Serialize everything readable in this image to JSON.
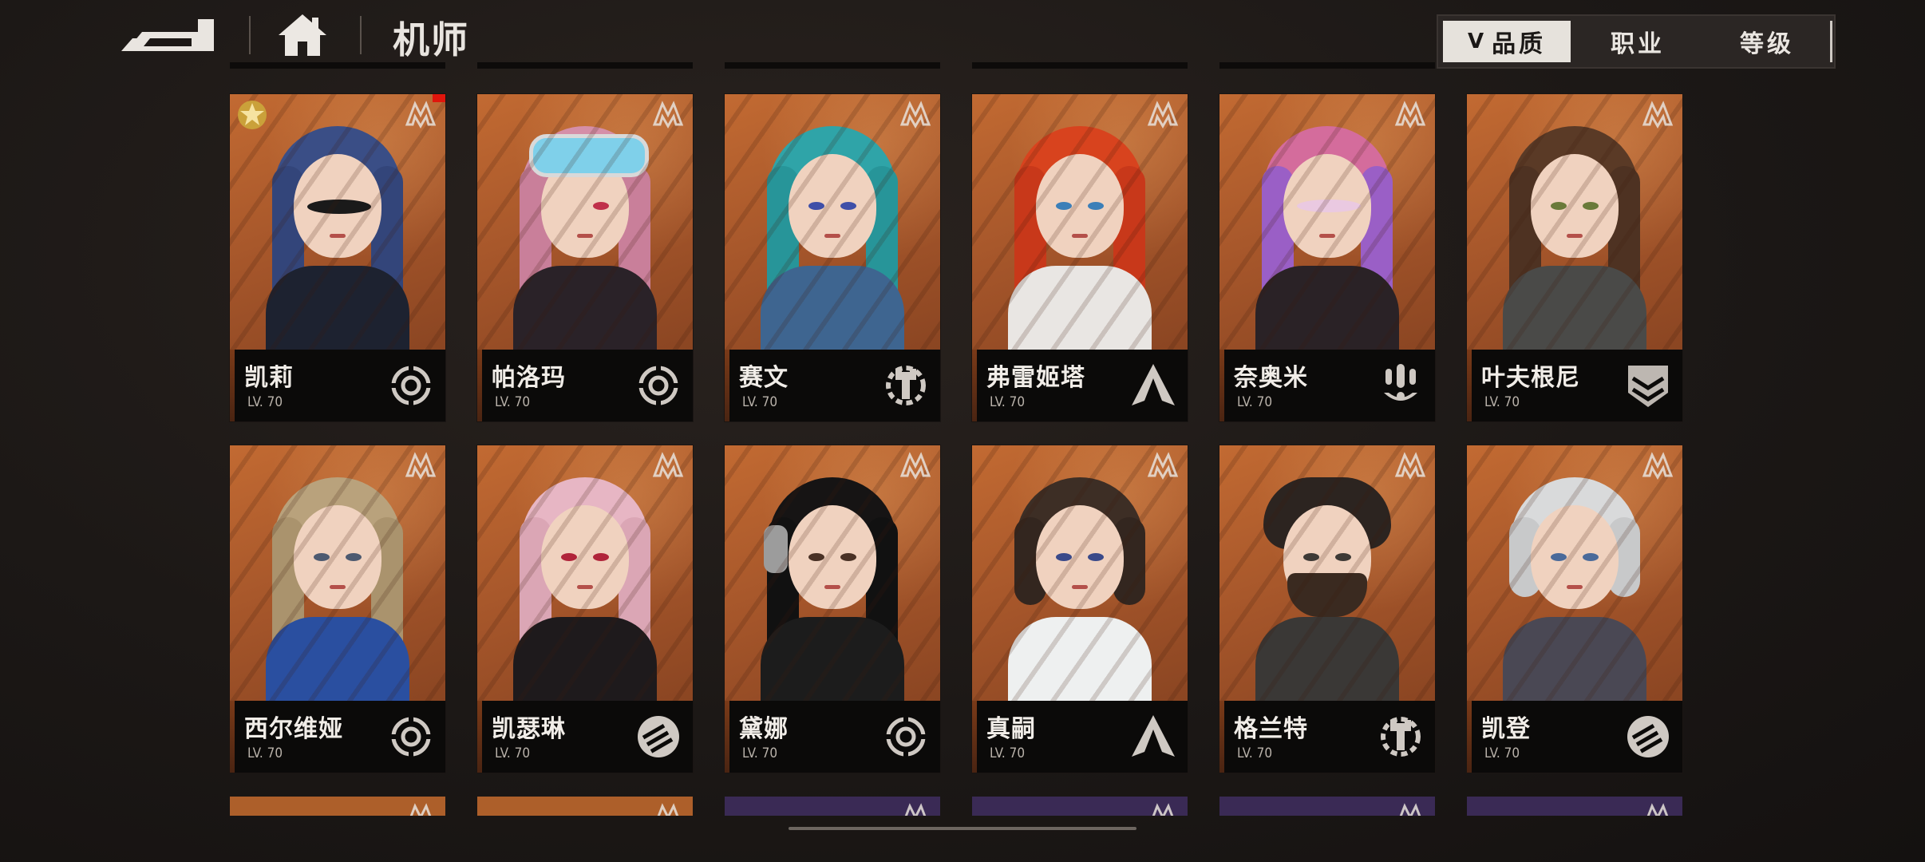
{
  "header": {
    "title": "机师"
  },
  "sort": {
    "tabs": [
      {
        "label": "品质",
        "active": true,
        "chevron": "V"
      },
      {
        "label": "职业",
        "active": false
      },
      {
        "label": "等级",
        "active": false
      }
    ]
  },
  "pilots": [
    {
      "name": "凯莉",
      "level": "LV. 70",
      "role_icon": "target-icon",
      "faction_icon": "faction-emblem-icon"
    },
    {
      "name": "帕洛玛",
      "level": "LV. 70",
      "role_icon": "target-icon",
      "faction_icon": "faction-emblem-icon"
    },
    {
      "name": "赛文",
      "level": "LV. 70",
      "role_icon": "wrench-gear-icon",
      "faction_icon": "faction-emblem-icon"
    },
    {
      "name": "弗雷姬塔",
      "level": "LV. 70",
      "role_icon": "blade-icon",
      "faction_icon": "faction-emblem-icon"
    },
    {
      "name": "奈奥米",
      "level": "LV. 70",
      "role_icon": "missile-icon",
      "faction_icon": "faction-emblem-icon"
    },
    {
      "name": "叶夫根尼",
      "level": "LV. 70",
      "role_icon": "shield-chevron-icon",
      "faction_icon": "faction-emblem-icon"
    },
    {
      "name": "西尔维娅",
      "level": "LV. 70",
      "role_icon": "target-icon",
      "faction_icon": "faction-emblem-icon"
    },
    {
      "name": "凯瑟琳",
      "level": "LV. 70",
      "role_icon": "fist-icon",
      "faction_icon": "faction-emblem-icon"
    },
    {
      "name": "黛娜",
      "level": "LV. 70",
      "role_icon": "target-icon",
      "faction_icon": "faction-emblem-icon"
    },
    {
      "name": "真嗣",
      "level": "LV. 70",
      "role_icon": "blade-icon",
      "faction_icon": "faction-emblem-icon"
    },
    {
      "name": "格兰特",
      "level": "LV. 70",
      "role_icon": "wrench-gear-icon",
      "faction_icon": "faction-emblem-icon"
    },
    {
      "name": "凯登",
      "level": "LV. 70",
      "role_icon": "fist-icon",
      "faction_icon": "faction-emblem-icon"
    }
  ],
  "colors": {
    "card_bg": "#ad5f2a",
    "info_bg": "#0b0a09",
    "active_tab": "#e6e2dc",
    "notification": "#e0150c"
  }
}
